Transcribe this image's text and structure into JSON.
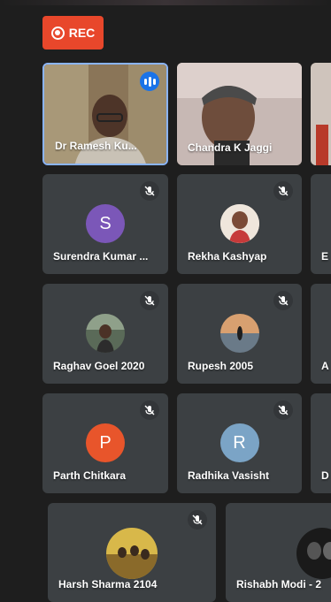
{
  "recording": {
    "label": "REC",
    "color": "#e8472b"
  },
  "participants": [
    {
      "name": "Dr Ramesh Ku...",
      "tile": "video",
      "speaking": true
    },
    {
      "name": "Chandra K Jaggi",
      "tile": "video"
    },
    {
      "name": "Surendra Kumar ...",
      "avatar_letter": "S",
      "avatar_color": "#7b57b8",
      "muted": true
    },
    {
      "name": "Rekha Kashyap",
      "avatar": "photo",
      "muted": true
    },
    {
      "name": "Raghav Goel 2020",
      "avatar": "photo",
      "muted": true
    },
    {
      "name": "Rupesh 2005",
      "avatar": "photo",
      "muted": true
    },
    {
      "name": "Parth Chitkara",
      "avatar_letter": "P",
      "avatar_color": "#e8552b",
      "muted": true
    },
    {
      "name": "Radhika Vasisht",
      "avatar_letter": "R",
      "avatar_color": "#7ba4c6",
      "muted": true
    },
    {
      "name": "Harsh Sharma 2104",
      "avatar": "photo",
      "muted": true
    },
    {
      "name": "Rishabh Modi - 2",
      "avatar": "photo",
      "muted": true
    }
  ],
  "partial_tiles": [
    {
      "initial": "E"
    },
    {
      "initial": "A"
    },
    {
      "initial": "D"
    }
  ]
}
